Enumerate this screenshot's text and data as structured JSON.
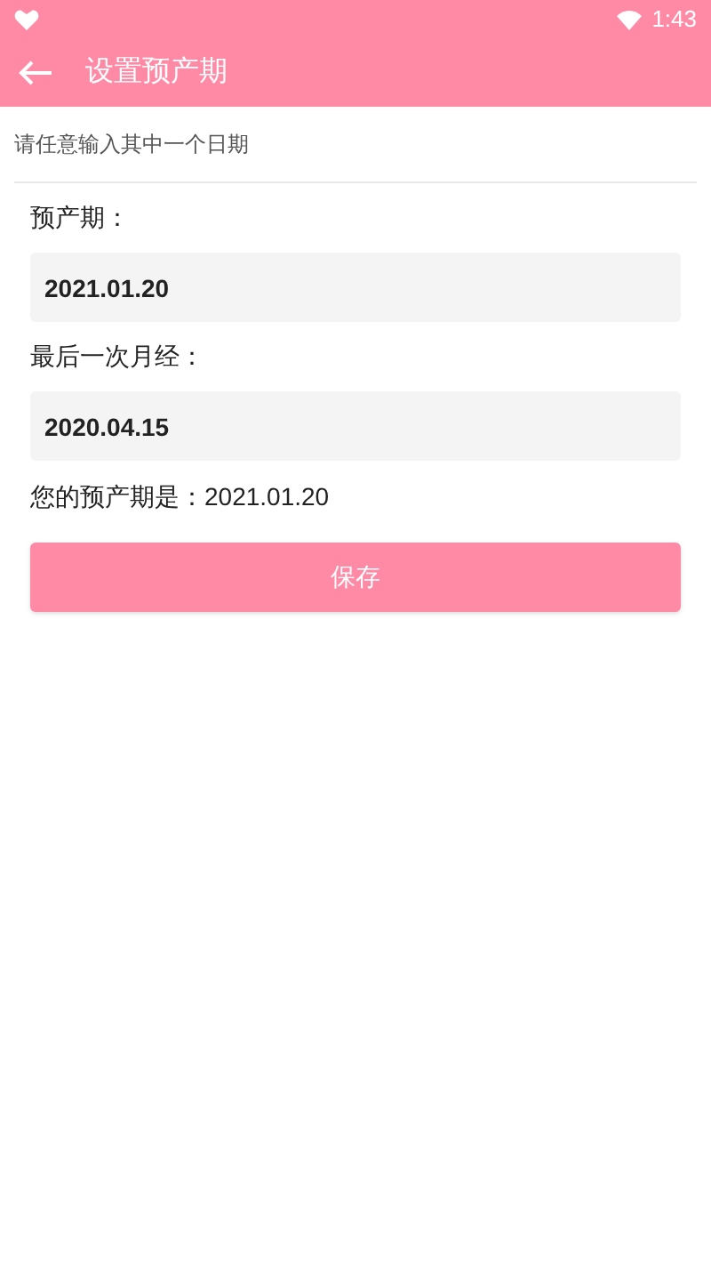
{
  "status_bar": {
    "time": "1:43"
  },
  "header": {
    "title": "设置预产期"
  },
  "hint": "请任意输入其中一个日期",
  "fields": [
    {
      "label": "预产期：",
      "value": "2021.01.20"
    },
    {
      "label": "最后一次月经：",
      "value": "2020.04.15"
    }
  ],
  "result": "您的预产期是：2021.01.20",
  "save_button": "保存"
}
